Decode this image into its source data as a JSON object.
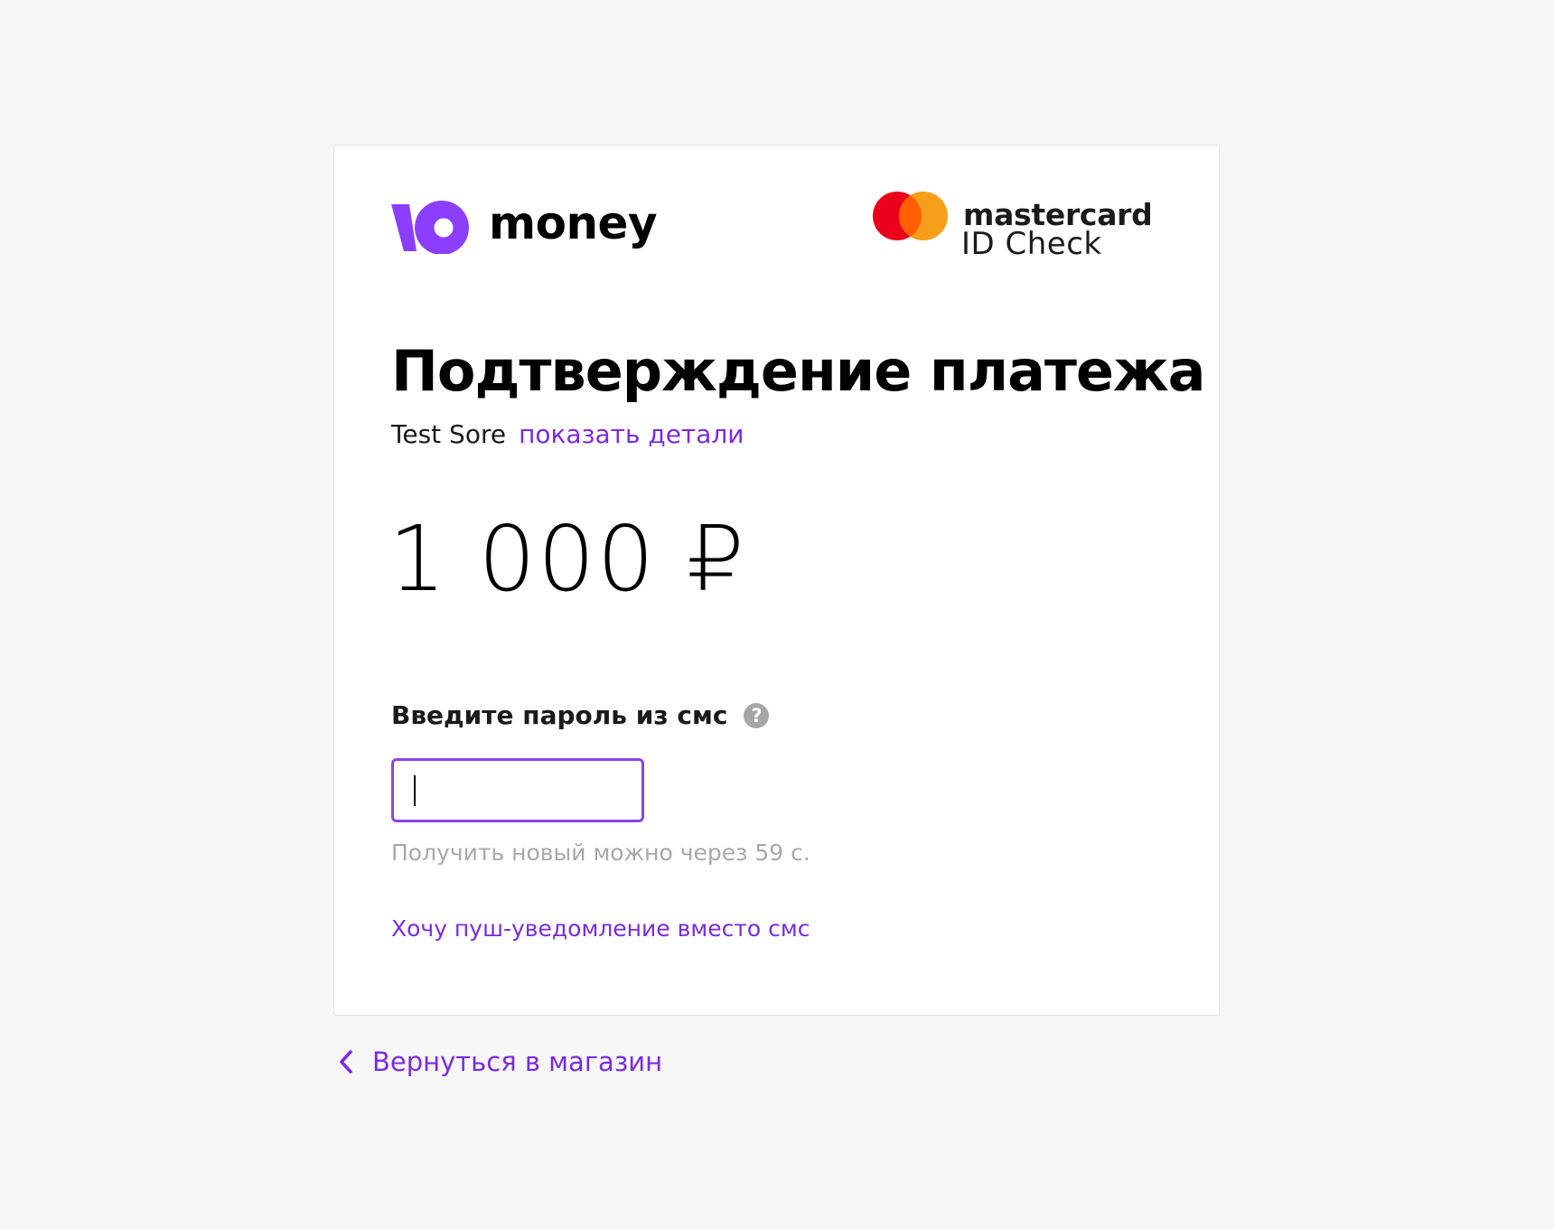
{
  "brand": {
    "wordmark": "money",
    "accent_color": "#8b3ffd"
  },
  "card_scheme": {
    "wordmark": "mastercard",
    "subtitle": "ID Check",
    "colors": {
      "red": "#eb001b",
      "orange": "#f79e1b",
      "overlap": "#ff5f00"
    }
  },
  "page": {
    "title": "Подтверждение платежа",
    "merchant": "Test Sore",
    "details_link": "показать детали",
    "amount": "1 000 ₽"
  },
  "otp": {
    "label": "Введите пароль из смс",
    "help_icon": "question-circle-icon",
    "help_glyph": "?",
    "value": "",
    "resend_hint": "Получить новый можно через 59 с.",
    "push_link": "Хочу пуш-уведомление вместо смс"
  },
  "footer": {
    "back_icon": "chevron-left-icon",
    "back_link": "Вернуться в магазин"
  },
  "colors": {
    "link": "#7b2be0",
    "input_border": "#8a44e8",
    "hint": "#a8a8a8",
    "background": "#f7f7f7"
  }
}
